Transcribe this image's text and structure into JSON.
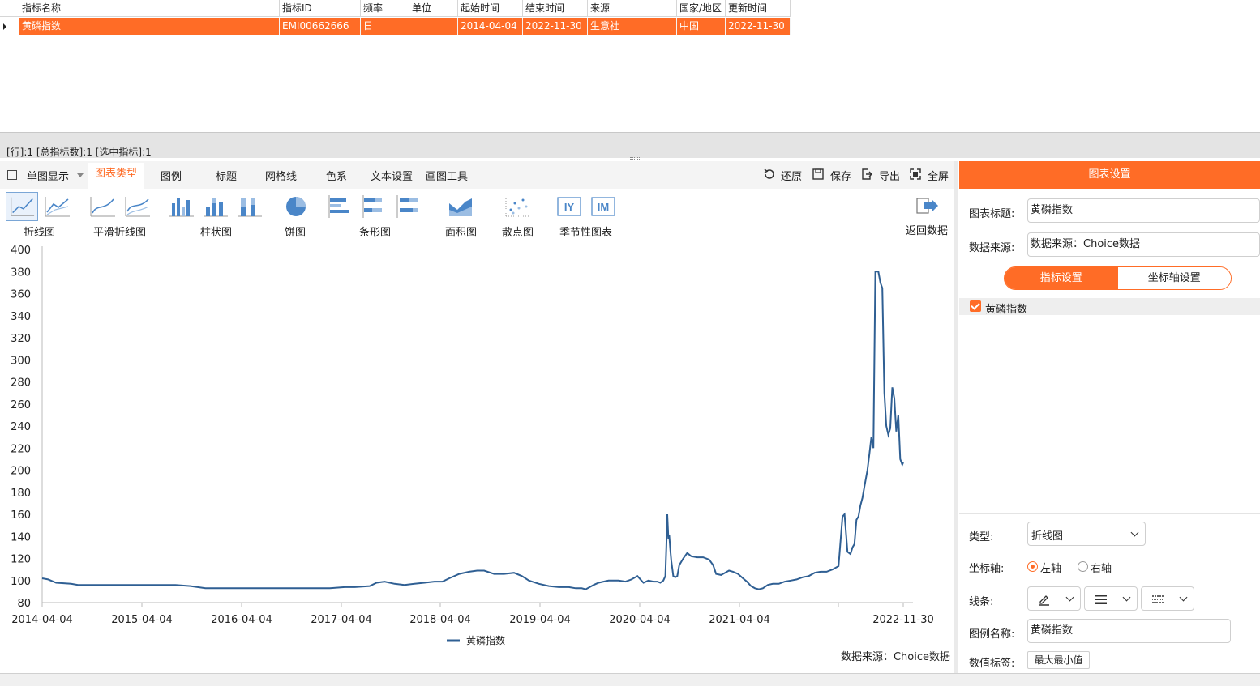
{
  "grid": {
    "columns": [
      "指标名称",
      "指标ID",
      "频率",
      "单位",
      "起始时间",
      "结束时间",
      "来源",
      "国家/地区",
      "更新时间"
    ],
    "rows": [
      [
        "黄磷指数",
        "EMI00662666",
        "日",
        "",
        "2014-04-04",
        "2022-11-30",
        "生意社",
        "中国",
        "2022-11-30"
      ]
    ]
  },
  "status": {
    "text": "[行]:1  [总指标数]:1  [选中指标]:1"
  },
  "toolbar": {
    "single_chart": "单图显示",
    "tabs": [
      "图表类型",
      "图例",
      "标题",
      "网格线",
      "色系",
      "文本设置",
      "画图工具"
    ],
    "active_tab": "图表类型",
    "actions": {
      "restore": "还原",
      "save": "保存",
      "export": "导出",
      "fullscreen": "全屏"
    }
  },
  "gallery": {
    "labels": {
      "line": "折线图",
      "smooth": "平滑折线图",
      "column": "柱状图",
      "pie": "饼图",
      "bar": "条形图",
      "area": "面积图",
      "scatter": "散点图",
      "seasonal": "季节性图表",
      "back": "返回数据"
    },
    "seasonal_icons": [
      "IY",
      "IM"
    ]
  },
  "chart_data": {
    "type": "line",
    "series": [
      {
        "name": "黄磷指数",
        "color": "#2f5f93"
      }
    ],
    "x_labels": [
      "2014-04-04",
      "2015-04-04",
      "2016-04-04",
      "2017-04-04",
      "2018-04-04",
      "2019-04-04",
      "2020-04-04",
      "2021-04-04",
      "2022-11-30"
    ],
    "y_ticks": [
      80,
      100,
      120,
      140,
      160,
      180,
      200,
      220,
      240,
      260,
      280,
      300,
      320,
      340,
      360,
      380,
      400
    ],
    "ylim": [
      80,
      400
    ],
    "x_domain": [
      2014.26,
      2022.91
    ],
    "points": [
      [
        2014.26,
        102
      ],
      [
        2014.32,
        101
      ],
      [
        2014.4,
        98
      ],
      [
        2014.55,
        97
      ],
      [
        2014.62,
        96
      ],
      [
        2014.8,
        96
      ],
      [
        2015.0,
        96
      ],
      [
        2015.3,
        96
      ],
      [
        2015.6,
        96
      ],
      [
        2015.75,
        95
      ],
      [
        2015.9,
        93
      ],
      [
        2016.1,
        93
      ],
      [
        2016.3,
        93
      ],
      [
        2016.6,
        93
      ],
      [
        2016.9,
        93
      ],
      [
        2017.05,
        93
      ],
      [
        2017.15,
        93
      ],
      [
        2017.3,
        94
      ],
      [
        2017.4,
        94
      ],
      [
        2017.55,
        95
      ],
      [
        2017.62,
        98
      ],
      [
        2017.7,
        99
      ],
      [
        2017.8,
        97
      ],
      [
        2017.9,
        96
      ],
      [
        2018.0,
        97
      ],
      [
        2018.1,
        98
      ],
      [
        2018.2,
        99
      ],
      [
        2018.28,
        99
      ],
      [
        2018.35,
        102
      ],
      [
        2018.45,
        106
      ],
      [
        2018.55,
        108
      ],
      [
        2018.63,
        109
      ],
      [
        2018.7,
        109
      ],
      [
        2018.8,
        106
      ],
      [
        2018.9,
        106
      ],
      [
        2019.0,
        107
      ],
      [
        2019.08,
        104
      ],
      [
        2019.15,
        100
      ],
      [
        2019.25,
        97
      ],
      [
        2019.35,
        95
      ],
      [
        2019.45,
        94
      ],
      [
        2019.55,
        94
      ],
      [
        2019.62,
        93
      ],
      [
        2019.68,
        93
      ],
      [
        2019.72,
        92
      ],
      [
        2019.76,
        94
      ],
      [
        2019.8,
        96
      ],
      [
        2019.85,
        98
      ],
      [
        2019.9,
        99
      ],
      [
        2019.95,
        100
      ],
      [
        2020.0,
        100
      ],
      [
        2020.05,
        100
      ],
      [
        2020.12,
        99
      ],
      [
        2020.18,
        101
      ],
      [
        2020.24,
        104
      ],
      [
        2020.3,
        98
      ],
      [
        2020.35,
        100
      ],
      [
        2020.4,
        99
      ],
      [
        2020.44,
        99
      ],
      [
        2020.47,
        98
      ],
      [
        2020.5,
        100
      ],
      [
        2020.52,
        104
      ],
      [
        2020.53,
        130
      ],
      [
        2020.54,
        160
      ],
      [
        2020.55,
        139
      ],
      [
        2020.56,
        140
      ],
      [
        2020.57,
        128
      ],
      [
        2020.58,
        118
      ],
      [
        2020.6,
        104
      ],
      [
        2020.62,
        103
      ],
      [
        2020.64,
        104
      ],
      [
        2020.66,
        114
      ],
      [
        2020.7,
        120
      ],
      [
        2020.74,
        125
      ],
      [
        2020.78,
        122
      ],
      [
        2020.84,
        121
      ],
      [
        2020.9,
        121
      ],
      [
        2020.96,
        119
      ],
      [
        2021.0,
        114
      ],
      [
        2021.03,
        106
      ],
      [
        2021.08,
        105
      ],
      [
        2021.12,
        107
      ],
      [
        2021.16,
        109
      ],
      [
        2021.2,
        108
      ],
      [
        2021.25,
        106
      ],
      [
        2021.3,
        102
      ],
      [
        2021.34,
        99
      ],
      [
        2021.38,
        95
      ],
      [
        2021.42,
        93
      ],
      [
        2021.46,
        92
      ],
      [
        2021.5,
        93
      ],
      [
        2021.55,
        96
      ],
      [
        2021.6,
        97
      ],
      [
        2021.66,
        97
      ],
      [
        2021.72,
        99
      ],
      [
        2021.78,
        100
      ],
      [
        2021.84,
        101
      ],
      [
        2021.9,
        103
      ],
      [
        2021.96,
        104
      ],
      [
        2022.02,
        107
      ],
      [
        2022.08,
        108
      ],
      [
        2022.14,
        108
      ],
      [
        2022.2,
        110
      ],
      [
        2022.26,
        113
      ],
      [
        2022.3,
        158
      ],
      [
        2022.32,
        160
      ],
      [
        2022.35,
        126
      ],
      [
        2022.38,
        124
      ],
      [
        2022.4,
        130
      ],
      [
        2022.42,
        133
      ],
      [
        2022.44,
        155
      ],
      [
        2022.46,
        158
      ],
      [
        2022.48,
        168
      ],
      [
        2022.5,
        175
      ],
      [
        2022.52,
        185
      ],
      [
        2022.55,
        200
      ],
      [
        2022.57,
        215
      ],
      [
        2022.59,
        230
      ],
      [
        2022.61,
        220
      ],
      [
        2022.63,
        380
      ],
      [
        2022.66,
        380
      ],
      [
        2022.68,
        370
      ],
      [
        2022.7,
        365
      ],
      [
        2022.72,
        270
      ],
      [
        2022.74,
        240
      ],
      [
        2022.76,
        232
      ],
      [
        2022.78,
        238
      ],
      [
        2022.8,
        275
      ],
      [
        2022.82,
        265
      ],
      [
        2022.84,
        235
      ],
      [
        2022.86,
        250
      ],
      [
        2022.88,
        210
      ],
      [
        2022.9,
        205
      ],
      [
        2022.91,
        207
      ]
    ],
    "legend_position": "bottom-center",
    "source": "数据来源：Choice数据"
  },
  "panel": {
    "title": "图表设置",
    "chart_title_label": "图表标题:",
    "chart_title_value": "黄磷指数",
    "source_label": "数据来源:",
    "source_value": "数据来源：Choice数据",
    "seg_on": "指标设置",
    "seg_off": "坐标轴设置",
    "series_item": "黄磷指数",
    "type_label": "类型:",
    "type_value": "折线图",
    "axis_label": "坐标轴:",
    "axis_left": "左轴",
    "axis_right": "右轴",
    "line_label": "线条:",
    "legend_name_label": "图例名称:",
    "legend_name_value": "黄磷指数",
    "value_label_label": "数值标签:",
    "value_label_btn": "最大最小值"
  },
  "colors": {
    "accent": "#ff6c26",
    "series": "#2f5f93",
    "icon_blue": "#4a86c8"
  }
}
